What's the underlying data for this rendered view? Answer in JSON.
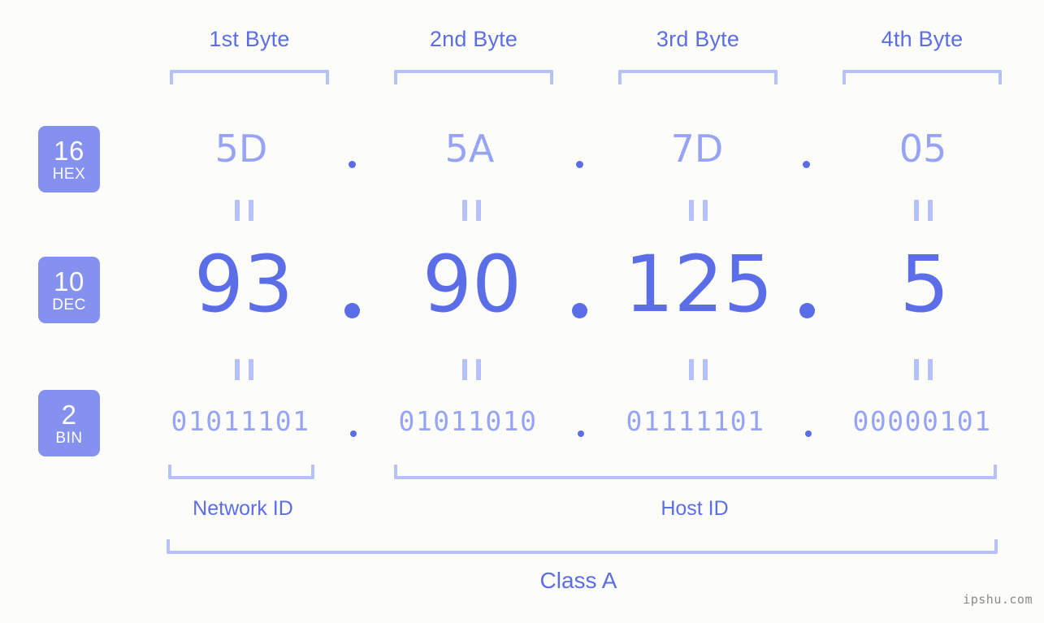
{
  "meta": {
    "background_color": "#fcfdf8",
    "accent_strong": "#5b6ee8",
    "accent_light": "#97a4f5",
    "accent_pale": "#b6c0fb",
    "badge_bg": "#8591ef"
  },
  "byte_headers": [
    {
      "label": "1st Byte"
    },
    {
      "label": "2nd Byte"
    },
    {
      "label": "3rd Byte"
    },
    {
      "label": "4th Byte"
    }
  ],
  "bases": [
    {
      "number": "16",
      "name": "HEX"
    },
    {
      "number": "10",
      "name": "DEC"
    },
    {
      "number": "2",
      "name": "BIN"
    }
  ],
  "rows": {
    "hex": [
      "5D",
      "5A",
      "7D",
      "05"
    ],
    "dec": [
      "93",
      "90",
      "125",
      "5"
    ],
    "bin": [
      "01011101",
      "01011010",
      "01111101",
      "00000101"
    ]
  },
  "separators": {
    "dot": ".",
    "equals": "=="
  },
  "segments": [
    {
      "label": "Network ID"
    },
    {
      "label": "Host ID"
    }
  ],
  "class": {
    "label": "Class A"
  },
  "watermark": {
    "text": "ipshu.com"
  }
}
